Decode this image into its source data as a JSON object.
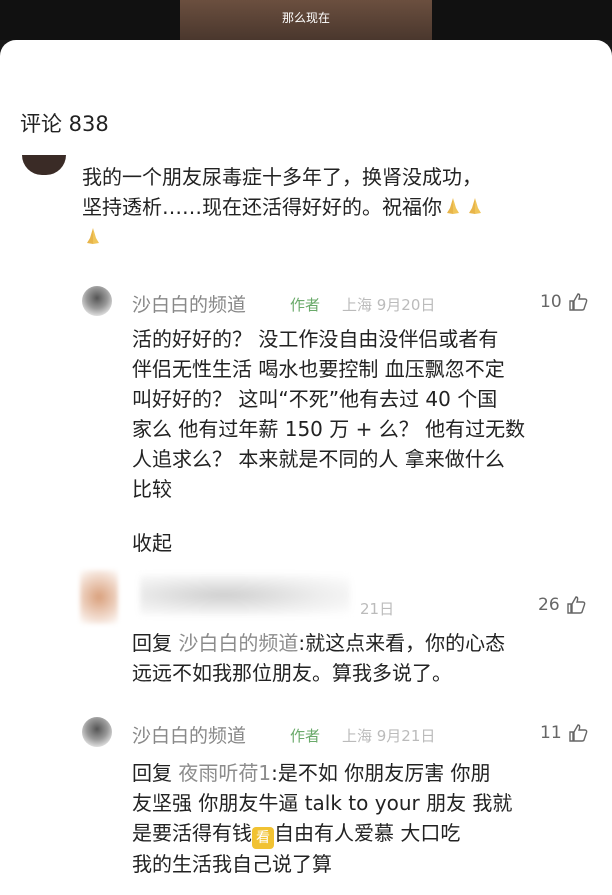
{
  "video": {
    "caption": "那么现在"
  },
  "comments": {
    "count_label": "评论 838",
    "top": {
      "text_line1": "我的一个朋友尿毒症十多年了，换肾没成功，",
      "text_line2": "坚持透析……现在还活得好好的。祝福你"
    },
    "reply1": {
      "name": "沙白白的频道",
      "author_tag": "作者",
      "meta": "上海 9月20日",
      "likes": "10",
      "lines": [
        "活的好好的？ 没工作没自由没伴侣或者有",
        "伴侣无性生活 喝水也要控制 血压飘忽不定",
        "叫好好的？ 这叫“不死”他有去过 40 个国",
        "家么 他有过年薪 150 万 + 么？ 他有过无数",
        "人追求么？ 本来就是不同的人 拿来做什么",
        "比较"
      ],
      "collapse": "收起"
    },
    "reply2": {
      "meta": "21日",
      "likes": "26",
      "prefix": "回复",
      "mention": "沙白白的频道",
      "text_line1_rest": ":就这点来看，你的心态",
      "text_line2": "远远不如我那位朋友。算我多说了。"
    },
    "reply3": {
      "name": "沙白白的频道",
      "author_tag": "作者",
      "meta": "上海 9月21日",
      "likes": "11",
      "prefix": "回复",
      "mention": "夜雨听荷1",
      "line1_rest": ":是不如 你朋友厉害 你朋",
      "line2": "友坚强 你朋友牛逼 talk to your 朋友 我就",
      "line3_a": "是要活得有钱",
      "sticker_label": "看",
      "line3_b": "自由有人爱慕 大口吃",
      "line4": "我的生活我自己说了算"
    }
  }
}
